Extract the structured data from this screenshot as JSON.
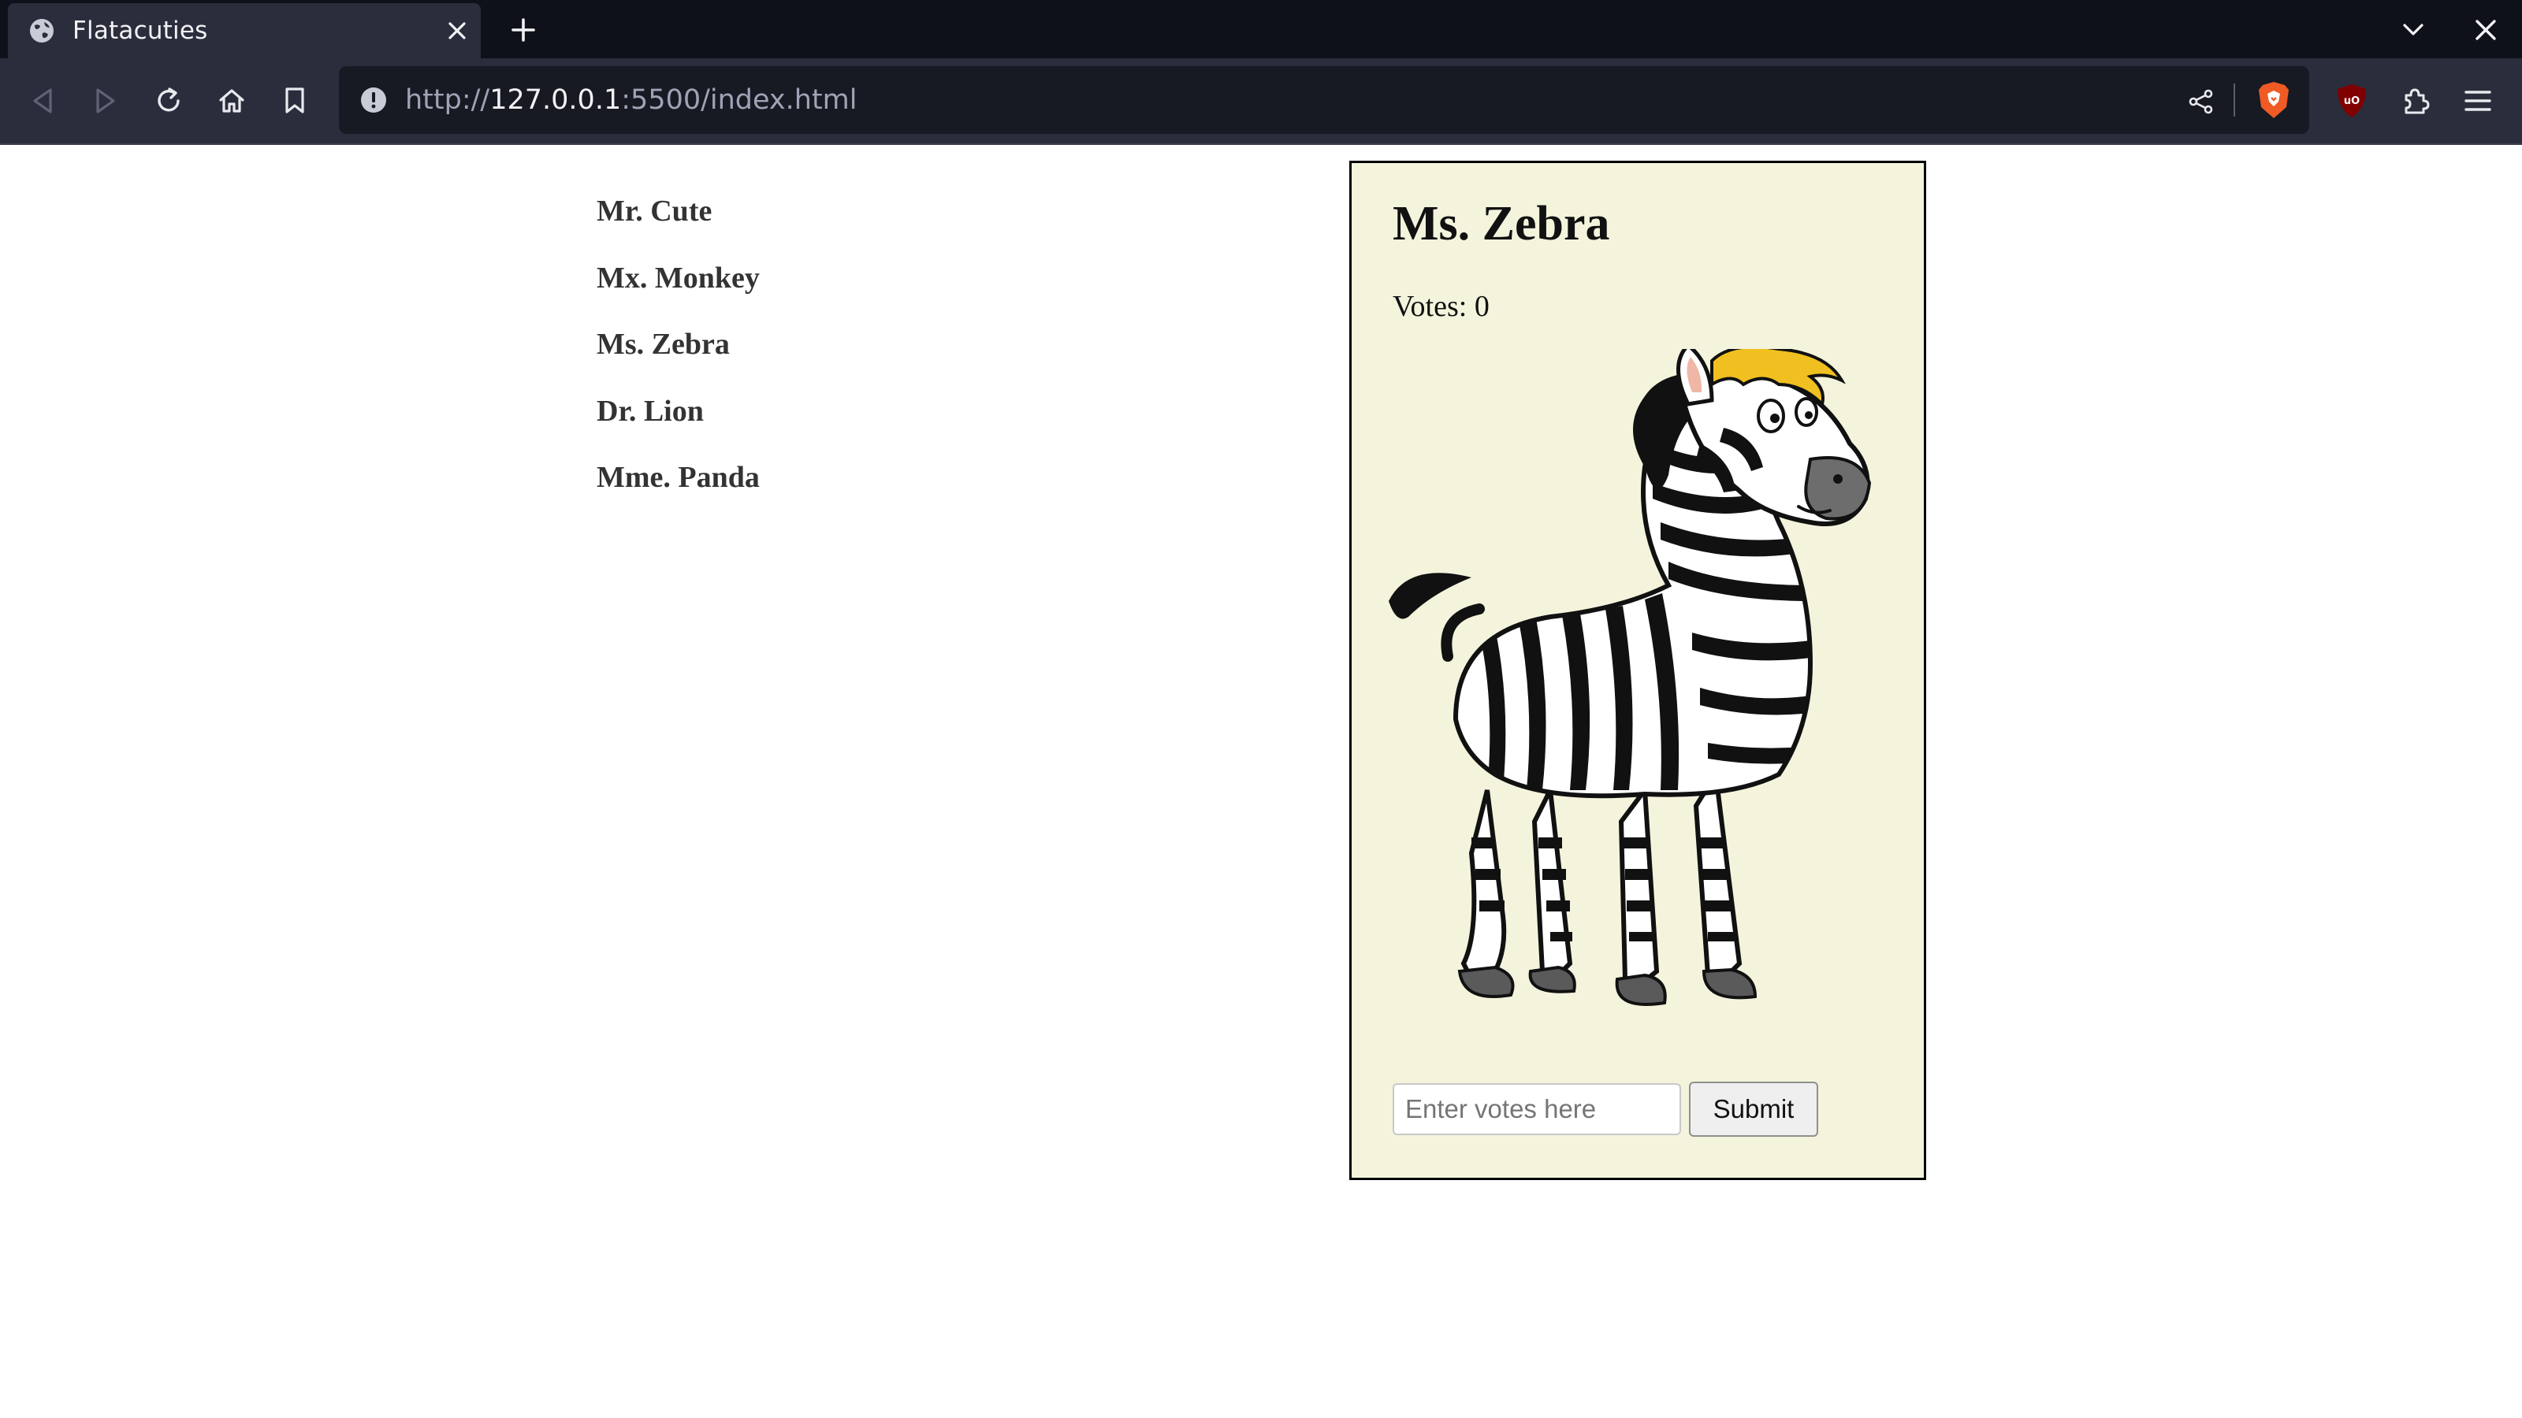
{
  "browser": {
    "tab_title": "Flatacuties",
    "url_prefix": "http://",
    "url_host": "127.0.0.1",
    "url_path": ":5500/index.html",
    "icons": [
      "globe-icon",
      "close-icon",
      "plus-icon",
      "chevron-down-icon",
      "back-icon",
      "forward-icon",
      "reload-icon",
      "home-icon",
      "bookmark-icon",
      "info-icon",
      "share-icon",
      "brave-shield-icon",
      "ublock-icon",
      "extensions-icon",
      "menu-icon"
    ],
    "colors": {
      "tabbar": "#0f111a",
      "toolbar": "#2a2d3b",
      "urlbar": "#171a23",
      "brave": "#f05a24",
      "ublock": "#800000"
    }
  },
  "characters": {
    "items": [
      "Mr. Cute",
      "Mx. Monkey",
      "Ms. Zebra",
      "Dr. Lion",
      "Mme. Panda"
    ]
  },
  "detail": {
    "name": "Ms. Zebra",
    "votes_label": "Votes:",
    "votes": "0",
    "image": "zebra-illustration",
    "card_bg": "#f4f4dd"
  },
  "form": {
    "placeholder": "Enter votes here",
    "submit_label": "Submit"
  }
}
